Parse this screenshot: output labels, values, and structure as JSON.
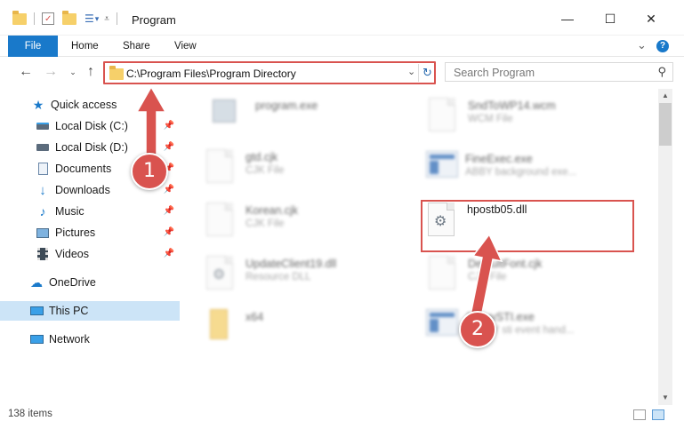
{
  "window": {
    "title": "Program",
    "minimize_symbol": "—",
    "maximize_symbol": "☐",
    "close_symbol": "✕"
  },
  "ribbon": {
    "tabs": [
      {
        "label": "File"
      },
      {
        "label": "Home"
      },
      {
        "label": "Share"
      },
      {
        "label": "View"
      }
    ],
    "collapse_symbol": "⌄",
    "help_symbol": "?"
  },
  "address": {
    "path": "C:\\Program Files\\Program Directory",
    "refresh_symbol": "↻"
  },
  "search": {
    "placeholder": "Search Program"
  },
  "sidebar": {
    "items": [
      {
        "label": "Quick access",
        "icon": "star-icon"
      },
      {
        "label": "Local Disk (C:)",
        "icon": "drive-icon"
      },
      {
        "label": "Local Disk (D:)",
        "icon": "drive-icon"
      },
      {
        "label": "Documents",
        "icon": "documents-icon"
      },
      {
        "label": "Downloads",
        "icon": "download-icon"
      },
      {
        "label": "Music",
        "icon": "music-icon"
      },
      {
        "label": "Pictures",
        "icon": "pictures-icon"
      },
      {
        "label": "Videos",
        "icon": "videos-icon"
      },
      {
        "label": "OneDrive",
        "icon": "cloud-icon"
      },
      {
        "label": "This PC",
        "icon": "computer-icon"
      },
      {
        "label": "Network",
        "icon": "network-icon"
      }
    ]
  },
  "files": [
    {
      "name": "program.exe",
      "type": ""
    },
    {
      "name": "SndToWP14.wcm",
      "type": "WCM File"
    },
    {
      "name": "gtd.cjk",
      "type": "CJK File"
    },
    {
      "name": "FineExec.exe",
      "type": "ABBY background exe..."
    },
    {
      "name": "Korean.cjk",
      "type": "CJK File"
    },
    {
      "name": "hpostb05.dll",
      "type": ""
    },
    {
      "name": "UpdateClient19.dll",
      "type": "Resource DLL"
    },
    {
      "name": "DefaultFont.cjk",
      "type": "CJK File"
    },
    {
      "name": "x64",
      "type": ""
    },
    {
      "name": "AbbyySTI.exe",
      "type": "ABBYY sti event hand..."
    }
  ],
  "annotations": {
    "step1": "1",
    "step2": "2",
    "color": "#d9534f"
  },
  "status": {
    "item_count": "138 items"
  }
}
